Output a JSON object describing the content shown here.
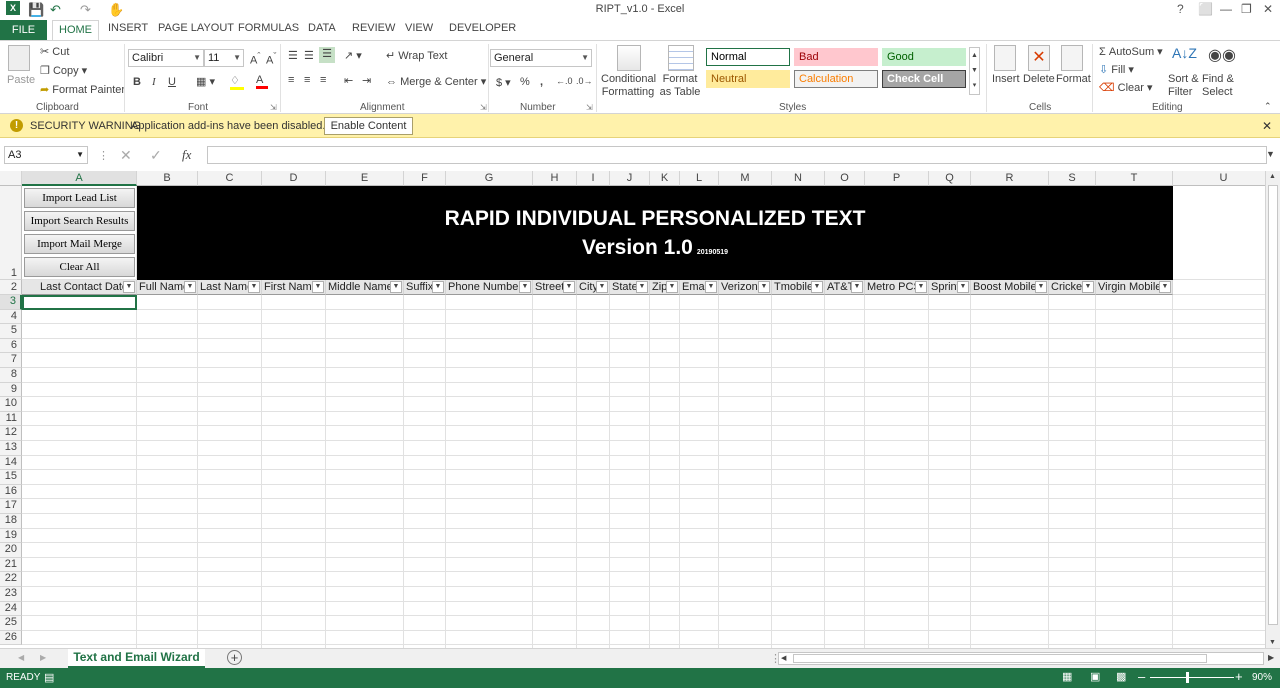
{
  "window": {
    "title": "RIPT_v1.0 - Excel",
    "help": "?",
    "controls": [
      "⬜",
      "—",
      "❐",
      "✕"
    ]
  },
  "ribbon_tabs": [
    "FILE",
    "HOME",
    "INSERT",
    "PAGE LAYOUT",
    "FORMULAS",
    "DATA",
    "REVIEW",
    "VIEW",
    "DEVELOPER"
  ],
  "clipboard": {
    "paste": "Paste",
    "cut": "Cut",
    "copy": "Copy",
    "format_painter": "Format Painter",
    "label": "Clipboard"
  },
  "font": {
    "name": "Calibri",
    "size": "11",
    "bold": "B",
    "italic": "I",
    "underline": "U",
    "label": "Font",
    "fill_color": "#ffff00",
    "font_color": "#ff0000"
  },
  "alignment": {
    "wrap": "Wrap Text",
    "merge": "Merge & Center",
    "label": "Alignment"
  },
  "number": {
    "format": "General",
    "currency": "$",
    "percent": "%",
    "comma": ",",
    "label": "Number"
  },
  "styles": {
    "conditional": "Conditional Formatting",
    "format_table": "Format as Table",
    "label": "Styles",
    "gallery": [
      {
        "name": "Normal",
        "bg": "#ffffff",
        "fg": "#000000",
        "border": "#217346"
      },
      {
        "name": "Bad",
        "bg": "#ffc7ce",
        "fg": "#9c0006",
        "border": "#ffc7ce"
      },
      {
        "name": "Good",
        "bg": "#c6efce",
        "fg": "#006100",
        "border": "#c6efce"
      },
      {
        "name": "Neutral",
        "bg": "#ffeb9c",
        "fg": "#9c5700",
        "border": "#ffeb9c"
      },
      {
        "name": "Calculation",
        "bg": "#f2f2f2",
        "fg": "#fa7d00",
        "border": "#7f7f7f"
      },
      {
        "name": "Check Cell",
        "bg": "#a5a5a5",
        "fg": "#ffffff",
        "border": "#3f3f3f"
      }
    ]
  },
  "cells": {
    "insert": "Insert",
    "delete": "Delete",
    "format": "Format",
    "label": "Cells"
  },
  "editing": {
    "autosum": "AutoSum",
    "fill": "Fill",
    "clear": "Clear",
    "sort": "Sort & Filter",
    "find": "Find & Select",
    "label": "Editing"
  },
  "security": {
    "title": "SECURITY WARNING",
    "message": "Application add-ins have been disabled.",
    "button": "Enable Content"
  },
  "formula_bar": {
    "name_box": "A3",
    "fx": "fx",
    "value": ""
  },
  "columns": [
    "A",
    "B",
    "C",
    "D",
    "E",
    "F",
    "G",
    "H",
    "I",
    "J",
    "K",
    "L",
    "M",
    "N",
    "O",
    "P",
    "Q",
    "R",
    "S",
    "T",
    "U"
  ],
  "rows": [
    "1",
    "2",
    "3",
    "4",
    "5",
    "6",
    "7",
    "8",
    "9",
    "10",
    "11",
    "12",
    "13",
    "14",
    "15",
    "16",
    "17",
    "18",
    "19",
    "20",
    "21",
    "22",
    "23",
    "24",
    "25",
    "26"
  ],
  "banner": {
    "title": "RAPID INDIVIDUAL PERSONALIZED TEXT",
    "version": "Version 1.0",
    "build": "20190519"
  },
  "macro_buttons": [
    "Import Lead List",
    "Import Search Results",
    "Import Mail Merge",
    "Clear All"
  ],
  "headers": [
    "Last Contact Date",
    "Full Name",
    "Last Name",
    "First Name",
    "Middle Name",
    "Suffix",
    "Phone Number",
    "Street",
    "City",
    "State",
    "Zip",
    "Email",
    "Verizon",
    "Tmobile",
    "AT&T",
    "Metro PCS",
    "Sprint",
    "Boost Mobile",
    "Cricket",
    "Virgin Mobile"
  ],
  "sheet_tab": "Text and Email Wizard",
  "status": {
    "ready": "READY",
    "zoom": "90%"
  }
}
